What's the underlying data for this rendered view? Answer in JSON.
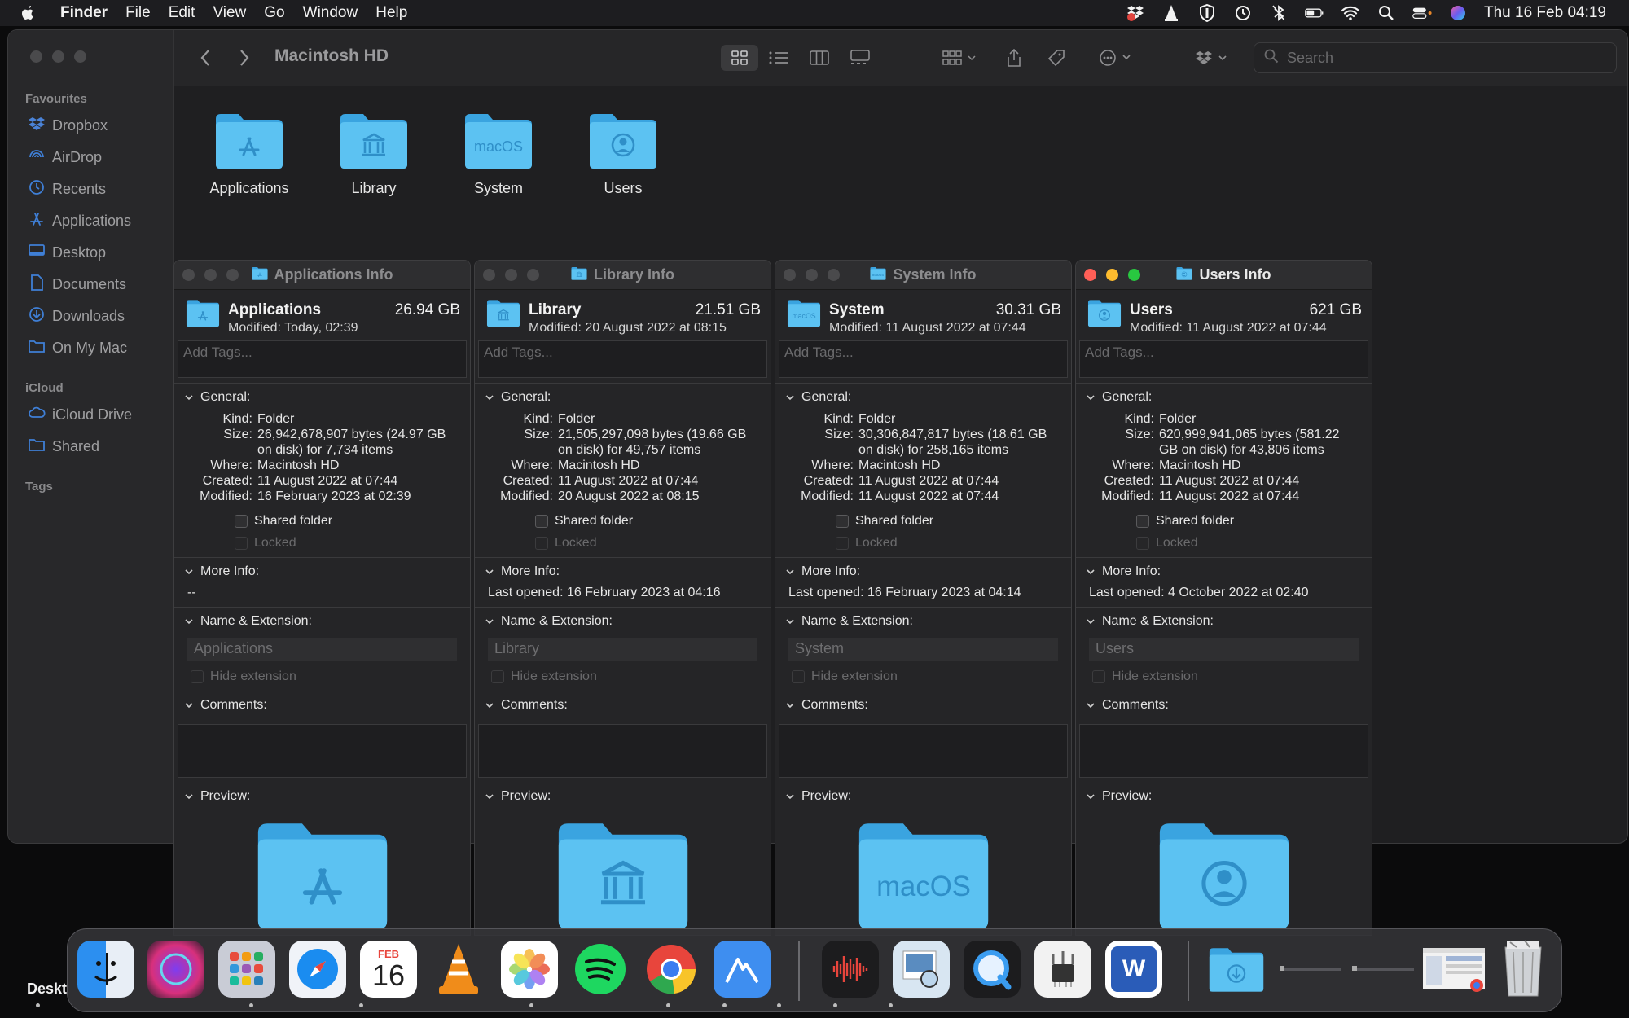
{
  "menubar": {
    "app_name": "Finder",
    "menus": [
      "File",
      "Edit",
      "View",
      "Go",
      "Window",
      "Help"
    ],
    "clock": "Thu 16 Feb  04:19"
  },
  "sidebar": {
    "favourites_title": "Favourites",
    "favourites": [
      {
        "label": "Dropbox",
        "icon": "dropbox-icon"
      },
      {
        "label": "AirDrop",
        "icon": "airdrop-icon"
      },
      {
        "label": "Recents",
        "icon": "clock-icon"
      },
      {
        "label": "Applications",
        "icon": "applications-icon"
      },
      {
        "label": "Desktop",
        "icon": "desktop-icon"
      },
      {
        "label": "Documents",
        "icon": "document-icon"
      },
      {
        "label": "Downloads",
        "icon": "download-icon"
      },
      {
        "label": "On My Mac",
        "icon": "folder-icon"
      }
    ],
    "icloud_title": "iCloud",
    "icloud": [
      {
        "label": "iCloud Drive",
        "icon": "cloud-icon"
      },
      {
        "label": "Shared",
        "icon": "shared-folder-icon"
      }
    ],
    "tags_title": "Tags"
  },
  "toolbar": {
    "title": "Macintosh HD",
    "search_placeholder": "Search"
  },
  "folders": [
    {
      "label": "Applications"
    },
    {
      "label": "Library"
    },
    {
      "label": "System"
    },
    {
      "label": "Users"
    }
  ],
  "info_labels": {
    "add_tags": "Add Tags...",
    "general": "General:",
    "kind": "Kind:",
    "size": "Size:",
    "where": "Where:",
    "created": "Created:",
    "modified": "Modified:",
    "shared_folder": "Shared folder",
    "locked": "Locked",
    "more_info": "More Info:",
    "name_extension": "Name & Extension:",
    "hide_extension": "Hide extension",
    "comments": "Comments:",
    "preview": "Preview:"
  },
  "info_windows": [
    {
      "title": "Applications Info",
      "name": "Applications",
      "size_short": "26.94 GB",
      "modified_line": "Modified:  Today, 02:39",
      "kind": "Folder",
      "size_line1": "26,942,678,907 bytes (24.97 GB",
      "size_line2": "on disk) for 7,734 items",
      "where": "Macintosh HD",
      "created": "11 August 2022 at 07:44",
      "modified": "16 February 2023 at 02:39",
      "more_info": "--",
      "name_field": "Applications"
    },
    {
      "title": "Library Info",
      "name": "Library",
      "size_short": "21.51 GB",
      "modified_line": "Modified:  20 August 2022 at 08:15",
      "kind": "Folder",
      "size_line1": "21,505,297,098 bytes (19.66 GB",
      "size_line2": "on disk) for 49,757 items",
      "where": "Macintosh HD",
      "created": "11 August 2022 at 07:44",
      "modified": "20 August 2022 at 08:15",
      "more_info": "Last opened:  16 February 2023 at 04:16",
      "name_field": "Library"
    },
    {
      "title": "System Info",
      "name": "System",
      "size_short": "30.31 GB",
      "modified_line": "Modified:  11 August 2022 at 07:44",
      "kind": "Folder",
      "size_line1": "30,306,847,817 bytes (18.61 GB",
      "size_line2": "on disk) for 258,165 items",
      "where": "Macintosh HD",
      "created": "11 August 2022 at 07:44",
      "modified": "11 August 2022 at 07:44",
      "more_info": "Last opened:  16 February 2023 at 04:14",
      "name_field": "System"
    },
    {
      "title": "Users Info",
      "name": "Users",
      "size_short": "621 GB",
      "modified_line": "Modified:  11 August 2022 at 07:44",
      "kind": "Folder",
      "size_line1": "620,999,941,065 bytes (581.22",
      "size_line2": "GB on disk) for 43,806 items",
      "where": "Macintosh HD",
      "created": "11 August 2022 at 07:44",
      "modified": "11 August 2022 at 07:44",
      "more_info": "Last opened:  4 October 2022 at 02:40",
      "name_field": "Users"
    }
  ],
  "folder_glyph_text": "macOS",
  "dock": {
    "apps": [
      "Finder",
      "Siri",
      "Launchpad",
      "Safari",
      "Calendar",
      "VLC",
      "Photos",
      "Spotify",
      "Chrome",
      "NordVPN",
      "Voice Memos",
      "Preview",
      "QuickTime Player",
      "System Information",
      "Microsoft Word",
      "Downloads",
      "Window 1",
      "Window 2",
      "Chrome Window",
      "Trash"
    ],
    "calendar_month": "FEB",
    "calendar_day": "16",
    "word_letter": "W"
  },
  "desktop_label": "Deskt"
}
